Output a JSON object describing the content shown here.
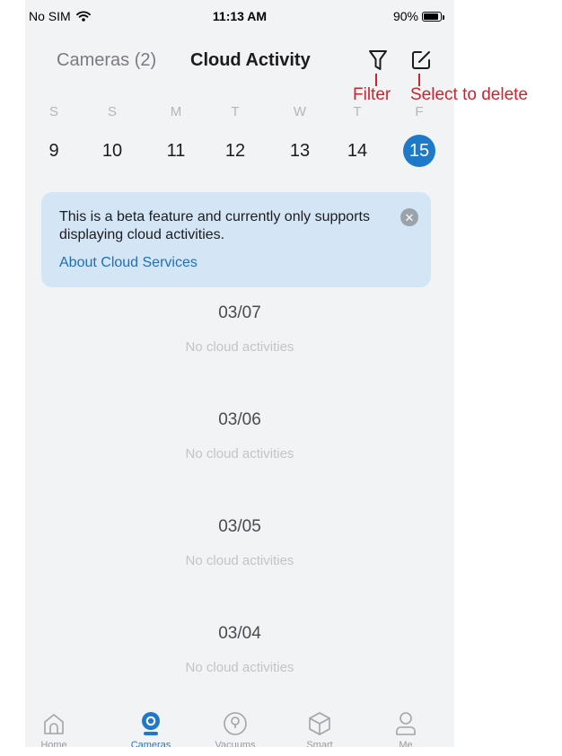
{
  "status_bar": {
    "carrier": "No SIM",
    "time": "11:13 AM",
    "battery": "90%",
    "battery_level": 0.9
  },
  "header": {
    "tab_cameras": "Cameras (2)",
    "tab_cloud": "Cloud Activity"
  },
  "calendar": {
    "weekdays": [
      "S",
      "S",
      "M",
      "T",
      "W",
      "T",
      "F"
    ],
    "dates": [
      "9",
      "10",
      "11",
      "12",
      "13",
      "14",
      "15"
    ],
    "selected_date": "15"
  },
  "banner": {
    "text": "This is a beta feature and currently only supports displaying cloud activities.",
    "link": "About Cloud Services"
  },
  "feed": [
    {
      "date": "03/07",
      "message": "No cloud activities"
    },
    {
      "date": "03/06",
      "message": "No cloud activities"
    },
    {
      "date": "03/05",
      "message": "No cloud activities"
    },
    {
      "date": "03/04",
      "message": "No cloud activities"
    }
  ],
  "tabbar": [
    {
      "label": "Home",
      "icon": "home-icon"
    },
    {
      "label": "Cameras",
      "icon": "camera-icon",
      "active": true
    },
    {
      "label": "Vacuums",
      "icon": "vacuum-icon"
    },
    {
      "label": "Smart",
      "icon": "cube-icon"
    },
    {
      "label": "Me",
      "icon": "person-icon"
    }
  ],
  "annotations": {
    "filter": "Filter",
    "delete": "Select to delete"
  },
  "colors": {
    "accent": "#1e79c8",
    "banner_bg": "#d4e6f5",
    "annotation": "#d0222c"
  }
}
